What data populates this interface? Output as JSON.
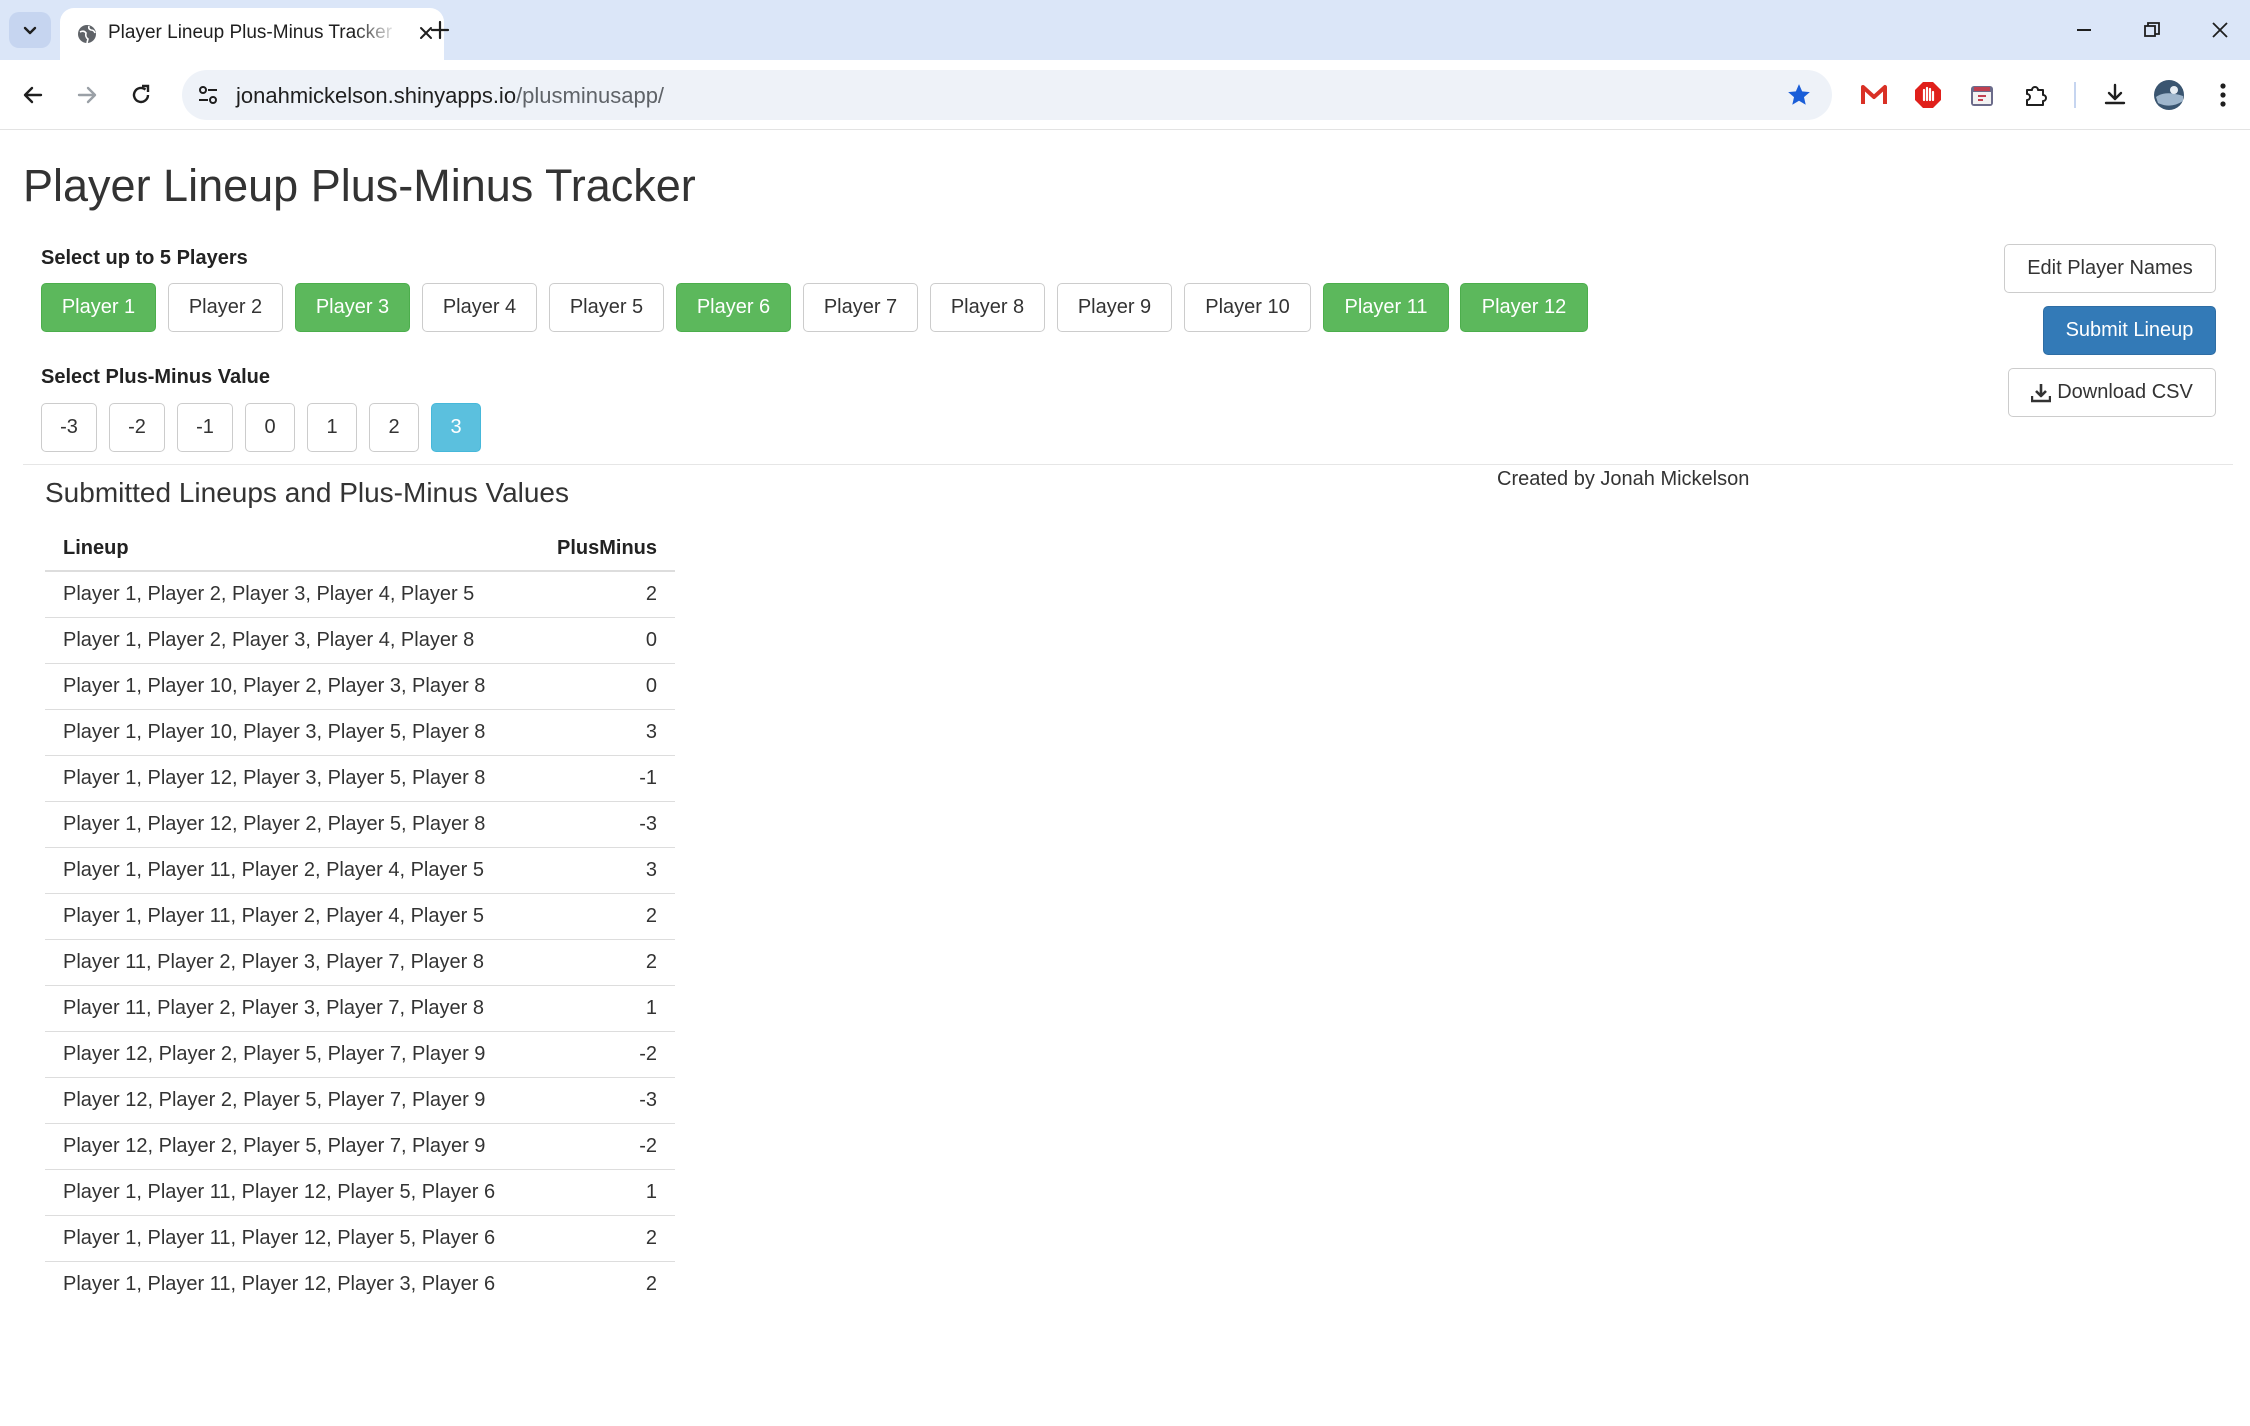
{
  "browser": {
    "tab_title": "Player Lineup Plus-Minus Tracker",
    "url_host": "jonahmickelson.shinyapps.io",
    "url_path": "/plusminusapp/"
  },
  "page": {
    "title": "Player Lineup Plus-Minus Tracker",
    "players_label": "Select up to 5 Players",
    "players": [
      {
        "label": "Player 1",
        "selected": true
      },
      {
        "label": "Player 2",
        "selected": false
      },
      {
        "label": "Player 3",
        "selected": true
      },
      {
        "label": "Player 4",
        "selected": false
      },
      {
        "label": "Player 5",
        "selected": false
      },
      {
        "label": "Player 6",
        "selected": true
      },
      {
        "label": "Player 7",
        "selected": false
      },
      {
        "label": "Player 8",
        "selected": false
      },
      {
        "label": "Player 9",
        "selected": false
      },
      {
        "label": "Player 10",
        "selected": false
      },
      {
        "label": "Player 11",
        "selected": true
      },
      {
        "label": "Player 12",
        "selected": true
      }
    ],
    "plusminus_label": "Select Plus-Minus Value",
    "plusminus_values": [
      {
        "label": "-3",
        "selected": false
      },
      {
        "label": "-2",
        "selected": false
      },
      {
        "label": "-1",
        "selected": false
      },
      {
        "label": "0",
        "selected": false
      },
      {
        "label": "1",
        "selected": false
      },
      {
        "label": "2",
        "selected": false
      },
      {
        "label": "3",
        "selected": true
      }
    ],
    "edit_names_label": "Edit Player Names",
    "submit_label": "Submit Lineup",
    "download_label": "Download CSV",
    "credit": "Created by Jonah Mickelson",
    "table_title": "Submitted Lineups and Plus-Minus Values",
    "table_headers": {
      "lineup": "Lineup",
      "plusminus": "PlusMinus"
    },
    "rows": [
      {
        "lineup": "Player 1, Player 2, Player 3, Player 4, Player 5",
        "pm": "2"
      },
      {
        "lineup": "Player 1, Player 2, Player 3, Player 4, Player 8",
        "pm": "0"
      },
      {
        "lineup": "Player 1, Player 10, Player 2, Player 3, Player 8",
        "pm": "0"
      },
      {
        "lineup": "Player 1, Player 10, Player 3, Player 5, Player 8",
        "pm": "3"
      },
      {
        "lineup": "Player 1, Player 12, Player 3, Player 5, Player 8",
        "pm": "-1"
      },
      {
        "lineup": "Player 1, Player 12, Player 2, Player 5, Player 8",
        "pm": "-3"
      },
      {
        "lineup": "Player 1, Player 11, Player 2, Player 4, Player 5",
        "pm": "3"
      },
      {
        "lineup": "Player 1, Player 11, Player 2, Player 4, Player 5",
        "pm": "2"
      },
      {
        "lineup": "Player 11, Player 2, Player 3, Player 7, Player 8",
        "pm": "2"
      },
      {
        "lineup": "Player 11, Player 2, Player 3, Player 7, Player 8",
        "pm": "1"
      },
      {
        "lineup": "Player 12, Player 2, Player 5, Player 7, Player 9",
        "pm": "-2"
      },
      {
        "lineup": "Player 12, Player 2, Player 5, Player 7, Player 9",
        "pm": "-3"
      },
      {
        "lineup": "Player 12, Player 2, Player 5, Player 7, Player 9",
        "pm": "-2"
      },
      {
        "lineup": "Player 1, Player 11, Player 12, Player 5, Player 6",
        "pm": "1"
      },
      {
        "lineup": "Player 1, Player 11, Player 12, Player 5, Player 6",
        "pm": "2"
      },
      {
        "lineup": "Player 1, Player 11, Player 12, Player 3, Player 6",
        "pm": "2"
      }
    ]
  },
  "colors": {
    "selected_player": "#5cb85c",
    "selected_value": "#5bc0de",
    "submit": "#337ab7",
    "tabbar": "#dbe6f8"
  }
}
